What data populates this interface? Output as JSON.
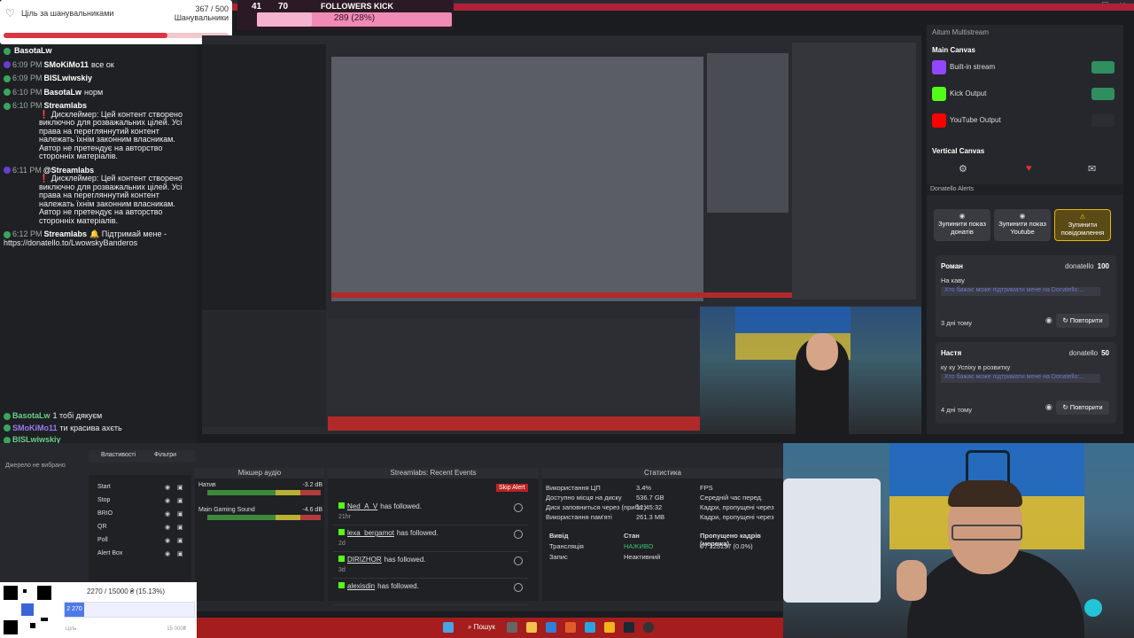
{
  "goal": {
    "title": "Ціль за шанувальниками",
    "count": "367 / 500",
    "sub": "Шанувальники",
    "progress": 0.73
  },
  "kick": {
    "stat1": "41",
    "stat2": "70",
    "label": "FOLLOWERS KICK",
    "value": "289 (28%)",
    "progress": 0.28
  },
  "chat": [
    {
      "time": "",
      "name": "BasotaLw",
      "text": "",
      "ic": "#3aa55d"
    },
    {
      "time": "6:09 PM",
      "name": "SMoKiMo11",
      "text": "все ок",
      "ic": "#6a3cd2"
    },
    {
      "time": "6:09 PM",
      "name": "BISLwiwskiy",
      "text": "",
      "ic": "#3aa55d"
    },
    {
      "time": "6:10 PM",
      "name": "BasotaLw",
      "text": "норм",
      "ic": "#3aa55d"
    },
    {
      "time": "6:10 PM",
      "name": "Streamlabs",
      "text": "",
      "body": "❗ Дисклеймер: Цей контент створено виключно для розважальних цілей. Усі права на перегляннутий контент належать їхнім законним власникам. Автор не претендує на авторство сторонніх матеріалів.",
      "ic": "#3aa55d"
    },
    {
      "time": "6:11 PM",
      "name": "@Streamlabs",
      "text": "",
      "body": "❗ Дисклеймер: Цей контент створено виключно для розважальних цілей. Усі права на перегляннутий контент належать їхнім законним власникам. Автор не претендує на авторство сторонніх матеріалів.",
      "ic": "#6a3cd2"
    },
    {
      "time": "6:12 PM",
      "name": "Streamlabs",
      "text": "🔔 Підтримай мене - https://donatello.to/LwowskyBanderos",
      "ic": "#3aa55d"
    }
  ],
  "chat_bottom": [
    {
      "name": "BasotaLw",
      "text": "1 тобі дякуєм"
    },
    {
      "name": "SMoKiMo11",
      "text": "ти красива ахєть"
    },
    {
      "name": "BISLwiwskiy",
      "text": ""
    },
    {
      "name": "@Streamlabs",
      "text": "Підтримай мене - https://donatello.to/LwowskyBanderos"
    },
    {
      "name": "SMoKiMo11",
      "text": "аззаза"
    }
  ],
  "right_panel": {
    "title": "Aitum Multistream",
    "main_canvas": "Main Canvas",
    "outputs": [
      {
        "label": "Built-in stream",
        "color": "#9146ff"
      },
      {
        "label": "Kick Output",
        "color": "#53fc18"
      },
      {
        "label": "YouTube Output",
        "color": "#ff0000"
      }
    ],
    "vertical_canvas": "Vertical Canvas",
    "alerts_title": "Donatello Alerts",
    "buttons": [
      "Зупинити показ донатів",
      "Зупинити показ Youtube",
      "Зупинити повідомлення"
    ],
    "cards": [
      {
        "name": "Роман",
        "source": "donatello",
        "amount": "100",
        "msg": "На каву",
        "link": "Хто бажає може підтримати мене на Donatello:...",
        "when": "3 дні тому",
        "retry": "Повторити"
      },
      {
        "name": "Настя",
        "source": "donatello",
        "amount": "50",
        "msg": "ку ку Успіху в розвитку",
        "link": "Хто бажає може підтримати мене на Donatello:...",
        "when": "4 дні тому",
        "retry": "Повторити"
      }
    ]
  },
  "obs": {
    "props_tab": "Властивості",
    "filters_tab": "Фільтри",
    "none_selected": "Джерело не вибрано",
    "sources": [
      "Start",
      "Stop",
      "BRIO",
      "QR",
      "Poll",
      "Alert Box"
    ],
    "mixer_title": "Мікшер аудіо",
    "mixer": [
      {
        "name": "Натив",
        "value": "-3.2 dB"
      },
      {
        "name": "Main Gaming Sound",
        "value": "-4.6 dB"
      }
    ],
    "events_title": "Streamlabs: Recent Events",
    "skip_alert": "Skip Alert",
    "events": [
      {
        "user": "Ned_A_V",
        "text": "has followed.",
        "ago": "21hr"
      },
      {
        "user": "lexa_bergamot",
        "text": "has followed.",
        "ago": "2d"
      },
      {
        "user": "DIRIZHOR",
        "text": "has followed.",
        "ago": "3d"
      },
      {
        "user": "alexisdin",
        "text": "has followed.",
        "ago": ""
      }
    ],
    "stats_title": "Статистика",
    "stats_left": [
      {
        "k": "Використання ЦП",
        "v": "3.4%"
      },
      {
        "k": "Доступно місця на диску",
        "v": "536.7 GB"
      },
      {
        "k": "Диск заповниться через (прибл.)",
        "v": "12:45:32"
      },
      {
        "k": "Використання пам'яті",
        "v": "261.3 MB"
      }
    ],
    "stats_right": [
      "FPS",
      "Середній час перед.",
      "Кадри, пропущені через",
      "Кадри, пропущені через"
    ],
    "out_headers": [
      "Вивід",
      "Стан",
      "Пропущено кадрів (мережа)"
    ],
    "out_rows": [
      {
        "a": "Трансляція",
        "b": "НАЖИВО",
        "c": "0 / 125137 (0.0%)"
      },
      {
        "a": "Запис",
        "b": "Неактивний",
        "c": ""
      }
    ]
  },
  "donation": {
    "value": "2270 / 15000 ₴ (15.13%)",
    "fill": "2 270",
    "min": "Ціль",
    "max": "15 000₴",
    "progress": 0.1513
  },
  "taskbar": {
    "search": "Пошук"
  }
}
